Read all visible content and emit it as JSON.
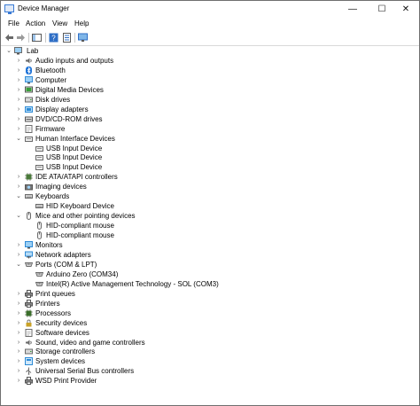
{
  "window": {
    "title": "Device Manager",
    "controls": {
      "minimize": "—",
      "maximize": "☐",
      "close": "✕"
    }
  },
  "menu": [
    "File",
    "Action",
    "View",
    "Help"
  ],
  "toolbar": [
    "back-arrow-icon",
    "forward-arrow-icon",
    "show-hide-console-tree-icon",
    "help-icon",
    "properties-icon",
    "scan-hardware-icon"
  ],
  "tree": [
    {
      "label": "Lab",
      "depth": 0,
      "expander": "expanded",
      "icon": "computer-icon"
    },
    {
      "label": "Audio inputs and outputs",
      "depth": 1,
      "expander": "collapsed",
      "icon": "speaker-icon",
      "color": "#6b6b6b"
    },
    {
      "label": "Bluetooth",
      "depth": 1,
      "expander": "collapsed",
      "icon": "bluetooth-icon",
      "color": "#1e73d8"
    },
    {
      "label": "Computer",
      "depth": 1,
      "expander": "collapsed",
      "icon": "computer-icon",
      "color": "#3b8fd8"
    },
    {
      "label": "Digital Media Devices",
      "depth": 1,
      "expander": "collapsed",
      "icon": "media-device-icon",
      "color": "#3a9e3a"
    },
    {
      "label": "Disk drives",
      "depth": 1,
      "expander": "collapsed",
      "icon": "disk-drive-icon",
      "color": "#6b6b6b"
    },
    {
      "label": "Display adapters",
      "depth": 1,
      "expander": "collapsed",
      "icon": "display-adapter-icon",
      "color": "#2e8bd6"
    },
    {
      "label": "DVD/CD-ROM drives",
      "depth": 1,
      "expander": "collapsed",
      "icon": "dvd-drive-icon",
      "color": "#555555"
    },
    {
      "label": "Firmware",
      "depth": 1,
      "expander": "collapsed",
      "icon": "firmware-icon",
      "color": "#6b6b6b"
    },
    {
      "label": "Human Interface Devices",
      "depth": 1,
      "expander": "expanded",
      "icon": "hid-icon",
      "color": "#6b6b6b"
    },
    {
      "label": "USB Input Device",
      "depth": 2,
      "expander": "none",
      "icon": "hid-icon",
      "color": "#6b6b6b"
    },
    {
      "label": "USB Input Device",
      "depth": 2,
      "expander": "none",
      "icon": "hid-icon",
      "color": "#6b6b6b"
    },
    {
      "label": "USB Input Device",
      "depth": 2,
      "expander": "none",
      "icon": "hid-icon",
      "color": "#6b6b6b"
    },
    {
      "label": "IDE ATA/ATAPI controllers",
      "depth": 1,
      "expander": "collapsed",
      "icon": "ide-controller-icon",
      "color": "#4a7a3a"
    },
    {
      "label": "Imaging devices",
      "depth": 1,
      "expander": "collapsed",
      "icon": "camera-icon",
      "color": "#555555"
    },
    {
      "label": "Keyboards",
      "depth": 1,
      "expander": "expanded",
      "icon": "keyboard-icon",
      "color": "#6b6b6b"
    },
    {
      "label": "HID Keyboard Device",
      "depth": 2,
      "expander": "none",
      "icon": "keyboard-icon",
      "color": "#6b6b6b"
    },
    {
      "label": "Mice and other pointing devices",
      "depth": 1,
      "expander": "expanded",
      "icon": "mouse-icon",
      "color": "#6b6b6b"
    },
    {
      "label": "HID-compliant mouse",
      "depth": 2,
      "expander": "none",
      "icon": "mouse-icon",
      "color": "#6b6b6b"
    },
    {
      "label": "HID-compliant mouse",
      "depth": 2,
      "expander": "none",
      "icon": "mouse-icon",
      "color": "#6b6b6b"
    },
    {
      "label": "Monitors",
      "depth": 1,
      "expander": "collapsed",
      "icon": "monitor-icon",
      "color": "#2e8bd6"
    },
    {
      "label": "Network adapters",
      "depth": 1,
      "expander": "collapsed",
      "icon": "network-adapter-icon",
      "color": "#2e8bd6"
    },
    {
      "label": "Ports (COM & LPT)",
      "depth": 1,
      "expander": "expanded",
      "icon": "port-icon",
      "color": "#6b6b6b"
    },
    {
      "label": "Arduino Zero (COM34)",
      "depth": 2,
      "expander": "none",
      "icon": "port-icon",
      "color": "#6b6b6b"
    },
    {
      "label": "Intel(R) Active Management Technology - SOL (COM3)",
      "depth": 2,
      "expander": "none",
      "icon": "port-icon",
      "color": "#6b6b6b"
    },
    {
      "label": "Print queues",
      "depth": 1,
      "expander": "collapsed",
      "icon": "printer-icon",
      "color": "#555555"
    },
    {
      "label": "Printers",
      "depth": 1,
      "expander": "collapsed",
      "icon": "printer-icon",
      "color": "#555555"
    },
    {
      "label": "Processors",
      "depth": 1,
      "expander": "collapsed",
      "icon": "processor-icon",
      "color": "#3a6e2a"
    },
    {
      "label": "Security devices",
      "depth": 1,
      "expander": "collapsed",
      "icon": "security-icon",
      "color": "#c9a227"
    },
    {
      "label": "Software devices",
      "depth": 1,
      "expander": "collapsed",
      "icon": "software-device-icon",
      "color": "#6b6b6b"
    },
    {
      "label": "Sound, video and game controllers",
      "depth": 1,
      "expander": "collapsed",
      "icon": "sound-icon",
      "color": "#6b6b6b"
    },
    {
      "label": "Storage controllers",
      "depth": 1,
      "expander": "collapsed",
      "icon": "storage-controller-icon",
      "color": "#6b6b6b"
    },
    {
      "label": "System devices",
      "depth": 1,
      "expander": "collapsed",
      "icon": "system-device-icon",
      "color": "#2e8bd6"
    },
    {
      "label": "Universal Serial Bus controllers",
      "depth": 1,
      "expander": "collapsed",
      "icon": "usb-icon",
      "color": "#6b6b6b"
    },
    {
      "label": "WSD Print Provider",
      "depth": 1,
      "expander": "collapsed",
      "icon": "printer-icon",
      "color": "#555555"
    }
  ]
}
